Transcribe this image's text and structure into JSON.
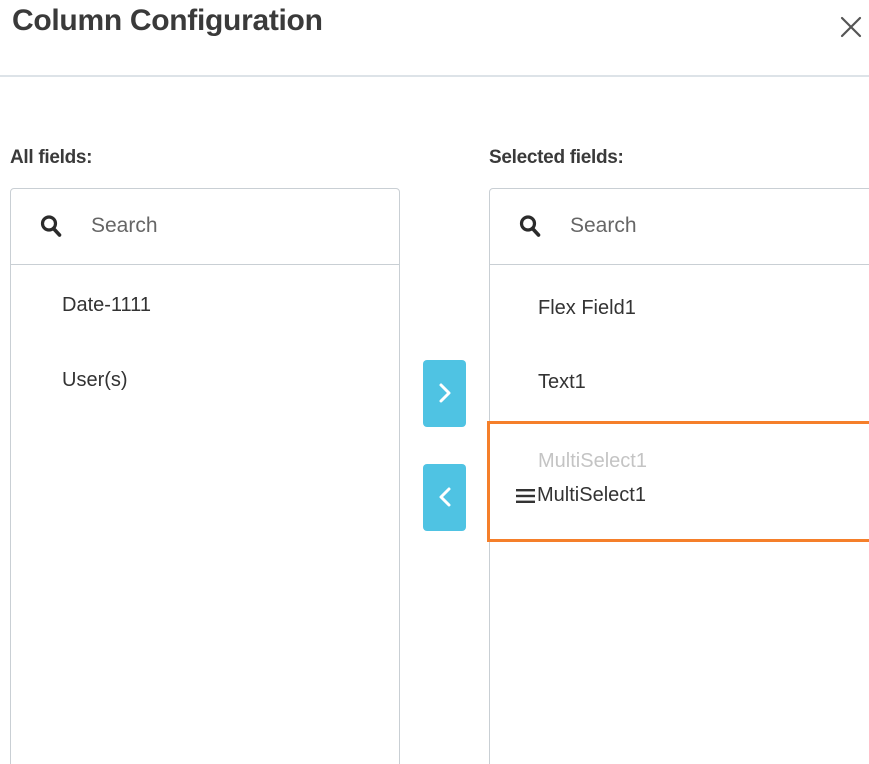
{
  "dialog": {
    "title": "Column Configuration",
    "close_icon": "close-icon"
  },
  "all_fields": {
    "label": "All fields:",
    "search_placeholder": "Search",
    "items": [
      {
        "label": "Date-1111"
      },
      {
        "label": "User(s)"
      }
    ]
  },
  "selected_fields": {
    "label": "Selected fields:",
    "search_placeholder": "Search",
    "items": [
      {
        "label": "Flex Field1"
      },
      {
        "label": "Text1"
      },
      {
        "label": "MultiSelect1"
      }
    ],
    "dragging": {
      "ghost_label": "MultiSelect1",
      "drag_label": "MultiSelect1",
      "handle_icon": "drag-handle-icon"
    }
  },
  "transfer": {
    "add_icon": "chevron-right-icon",
    "remove_icon": "chevron-left-icon"
  },
  "colors": {
    "accent": "#4fc3e3",
    "drop_highlight": "#f57f2a",
    "border": "#c9cfd4"
  }
}
